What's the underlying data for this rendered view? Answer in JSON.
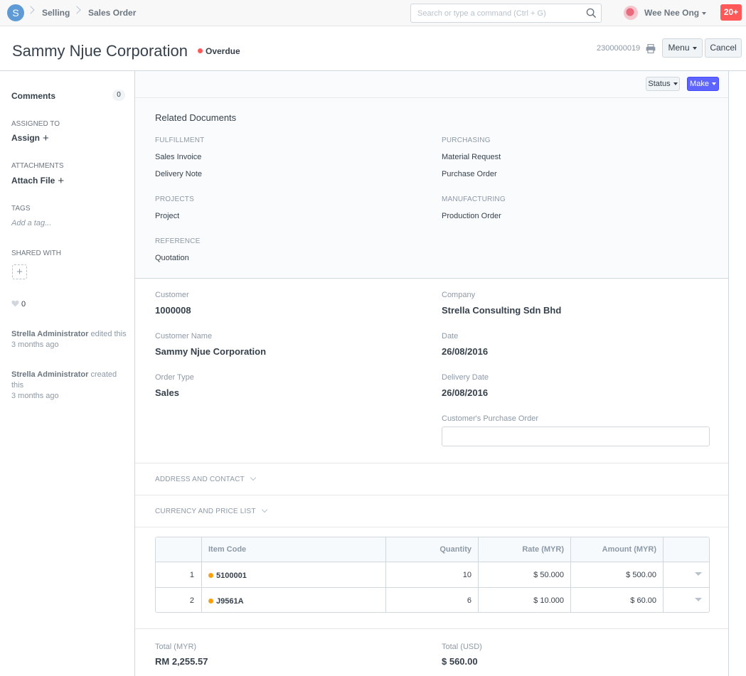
{
  "nav": {
    "logo_letter": "S",
    "breadcrumbs": [
      "Selling",
      "Sales Order"
    ],
    "search_placeholder": "Search or type a command (Ctrl + G)",
    "user_name": "Wee Nee Ong",
    "notifications": "20+"
  },
  "header": {
    "title": "Sammy Njue Corporation",
    "status": "Overdue",
    "status_color": "#ff5858",
    "doc_number": "2300000019",
    "menu_label": "Menu",
    "cancel_label": "Cancel"
  },
  "sidebar": {
    "comments_label": "Comments",
    "comments_count": "0",
    "assigned_to_label": "Assigned To",
    "assign_label": "Assign",
    "attachments_label": "Attachments",
    "attach_label": "Attach File",
    "tags_label": "Tags",
    "tag_placeholder": "Add a tag...",
    "shared_with_label": "Shared With",
    "likes": "0",
    "activity": [
      {
        "user": "Strella Administrator",
        "action": "edited this",
        "time": "3 months ago"
      },
      {
        "user": "Strella Administrator",
        "action": "created this",
        "time": "3 months ago"
      }
    ]
  },
  "toolbar": {
    "status_label": "Status",
    "make_label": "Make"
  },
  "related": {
    "title": "Related Documents",
    "groups": {
      "fulfillment": {
        "heading": "Fulfillment",
        "links": [
          "Sales Invoice",
          "Delivery Note"
        ]
      },
      "purchasing": {
        "heading": "Purchasing",
        "links": [
          "Material Request",
          "Purchase Order"
        ]
      },
      "projects": {
        "heading": "Projects",
        "links": [
          "Project"
        ]
      },
      "manufacturing": {
        "heading": "Manufacturing",
        "links": [
          "Production Order"
        ]
      },
      "reference": {
        "heading": "Reference",
        "links": [
          "Quotation"
        ]
      }
    }
  },
  "fields": {
    "customer": {
      "label": "Customer",
      "value": "1000008"
    },
    "company": {
      "label": "Company",
      "value": "Strella Consulting Sdn Bhd"
    },
    "customer_name": {
      "label": "Customer Name",
      "value": "Sammy Njue Corporation"
    },
    "date": {
      "label": "Date",
      "value": "26/08/2016"
    },
    "order_type": {
      "label": "Order Type",
      "value": "Sales"
    },
    "delivery_date": {
      "label": "Delivery Date",
      "value": "26/08/2016"
    },
    "customer_po": {
      "label": "Customer's Purchase Order",
      "value": ""
    }
  },
  "sections": {
    "address_contact": "Address and Contact",
    "currency_price_list": "Currency and Price List"
  },
  "items_table": {
    "headers": {
      "item_code": "Item Code",
      "quantity": "Quantity",
      "rate": "Rate (MYR)",
      "amount": "Amount (MYR)"
    },
    "rows": [
      {
        "idx": "1",
        "item_code": "5100001",
        "quantity": "10",
        "rate": "$ 50.000",
        "amount": "$ 500.00"
      },
      {
        "idx": "2",
        "item_code": "J9561A",
        "quantity": "6",
        "rate": "$ 10.000",
        "amount": "$ 60.00"
      }
    ]
  },
  "totals": {
    "total_myr": {
      "label": "Total (MYR)",
      "value": "RM 2,255.57"
    },
    "total_usd": {
      "label": "Total (USD)",
      "value": "$ 560.00"
    }
  }
}
